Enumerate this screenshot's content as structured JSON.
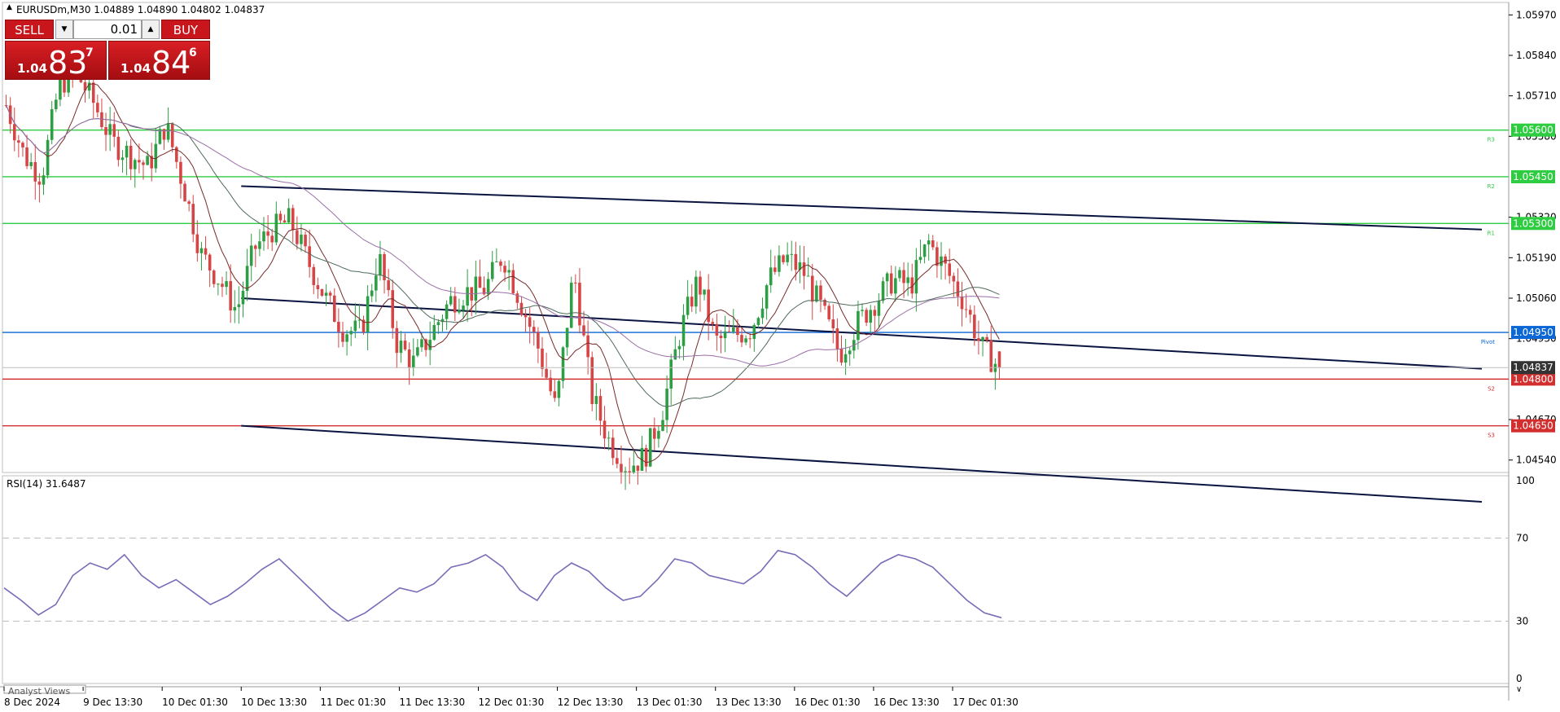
{
  "header": {
    "title": "EURUSDm,M30  1.04889 1.04890 1.04802 1.04837"
  },
  "trade_panel": {
    "sell_label": "SELL",
    "buy_label": "BUY",
    "lot_value": "0.01",
    "sell_price": {
      "small": "1.04",
      "big": "83",
      "sup": "7"
    },
    "buy_price": {
      "small": "1.04",
      "big": "84",
      "sup": "6"
    },
    "sell_color": "#c8161c",
    "buy_color": "#c8161c"
  },
  "price_axis": {
    "ticks": [
      "1.05970",
      "1.05840",
      "1.05710",
      "1.05580",
      "1.05320",
      "1.05190",
      "1.05060",
      "1.04930",
      "1.04670",
      "1.04540"
    ],
    "current_price": "1.04837"
  },
  "levels": [
    {
      "name": "R3",
      "label": "1.05600",
      "value": 1.056,
      "color": "#2ecc40",
      "tag": "R3"
    },
    {
      "name": "R2",
      "label": "1.05450",
      "value": 1.0545,
      "color": "#2ecc40",
      "tag": "R2"
    },
    {
      "name": "R1",
      "label": "1.05300",
      "value": 1.053,
      "color": "#2ecc40",
      "tag": "R1"
    },
    {
      "name": "pivot",
      "label": "1.04950",
      "value": 1.0495,
      "color": "#0b66d6",
      "tag": "Pivot"
    },
    {
      "name": "S2",
      "label": "1.04800",
      "value": 1.048,
      "color": "#d32f2f",
      "tag": "S2"
    },
    {
      "name": "S3",
      "label": "1.04650",
      "value": 1.0465,
      "color": "#d32f2f",
      "tag": "S3"
    }
  ],
  "rsi": {
    "label": "RSI(14) 31.6487",
    "ticks": [
      "100",
      "70",
      "30",
      "0"
    ],
    "overbought": 70,
    "oversold": 30,
    "line_color": "#7b6ab8"
  },
  "time_axis": {
    "labels": [
      "8 Dec 2024",
      "9 Dec 13:30",
      "10 Dec 01:30",
      "10 Dec 13:30",
      "11 Dec 01:30",
      "11 Dec 13:30",
      "12 Dec 01:30",
      "12 Dec 13:30",
      "13 Dec 01:30",
      "13 Dec 13:30",
      "16 Dec 01:30",
      "16 Dec 13:30",
      "17 Dec 01:30"
    ]
  },
  "bottom_tab": {
    "label": "Analyst Views"
  },
  "chart_data": {
    "type": "candlestick",
    "symbol": "EURUSDm",
    "timeframe": "M30",
    "ohlc_last": {
      "open": 1.04889,
      "high": 1.0489,
      "low": 1.04802,
      "close": 1.04837
    },
    "x": [
      "8 Dec 2024",
      "9 Dec 13:30",
      "10 Dec 01:30",
      "10 Dec 13:30",
      "11 Dec 01:30",
      "11 Dec 13:30",
      "12 Dec 01:30",
      "12 Dec 13:30",
      "13 Dec 01:30",
      "13 Dec 13:30",
      "16 Dec 01:30",
      "16 Dec 13:30",
      "17 Dec 01:30"
    ],
    "close_path": [
      1.0568,
      1.0552,
      1.0545,
      1.0575,
      1.0578,
      1.0568,
      1.0556,
      1.0552,
      1.0548,
      1.0562,
      1.0542,
      1.052,
      1.0512,
      1.0502,
      1.0522,
      1.0528,
      1.0531,
      1.0518,
      1.0506,
      1.0496,
      1.0495,
      1.052,
      1.0492,
      1.0485,
      1.0495,
      1.0505,
      1.0508,
      1.0509,
      1.052,
      1.0505,
      1.049,
      1.047,
      1.0515,
      1.0475,
      1.046,
      1.0452,
      1.0455,
      1.047,
      1.0495,
      1.0512,
      1.0492,
      1.0494,
      1.0496,
      1.0512,
      1.0519,
      1.0514,
      1.0502,
      1.0488,
      1.0498,
      1.0505,
      1.0512,
      1.051,
      1.0524,
      1.0515,
      1.0505,
      1.049,
      1.04837
    ],
    "ylim": [
      1.045,
      1.0601
    ],
    "channel_lines": [
      {
        "from": [
          "10 Dec 13:30",
          1.0542
        ],
        "to": [
          "17 Dec 01:30",
          1.0534
        ]
      },
      {
        "from": [
          "10 Dec 13:30",
          1.0506
        ],
        "to": [
          "17 Dec 01:30",
          1.0493
        ]
      },
      {
        "from": [
          "10 Dec 13:30",
          1.0465
        ],
        "to": [
          "17 Dec 01:30",
          1.0451
        ]
      }
    ],
    "rsi_series": [
      46,
      40,
      33,
      38,
      52,
      58,
      55,
      62,
      52,
      46,
      50,
      44,
      38,
      42,
      48,
      55,
      60,
      52,
      44,
      36,
      30,
      34,
      40,
      46,
      44,
      48,
      56,
      58,
      62,
      56,
      45,
      40,
      52,
      58,
      54,
      46,
      40,
      42,
      50,
      60,
      58,
      52,
      50,
      48,
      54,
      64,
      62,
      56,
      48,
      42,
      50,
      58,
      62,
      60,
      56,
      48,
      40,
      34,
      31.6487
    ],
    "rsi_ylim": [
      0,
      100
    ]
  }
}
